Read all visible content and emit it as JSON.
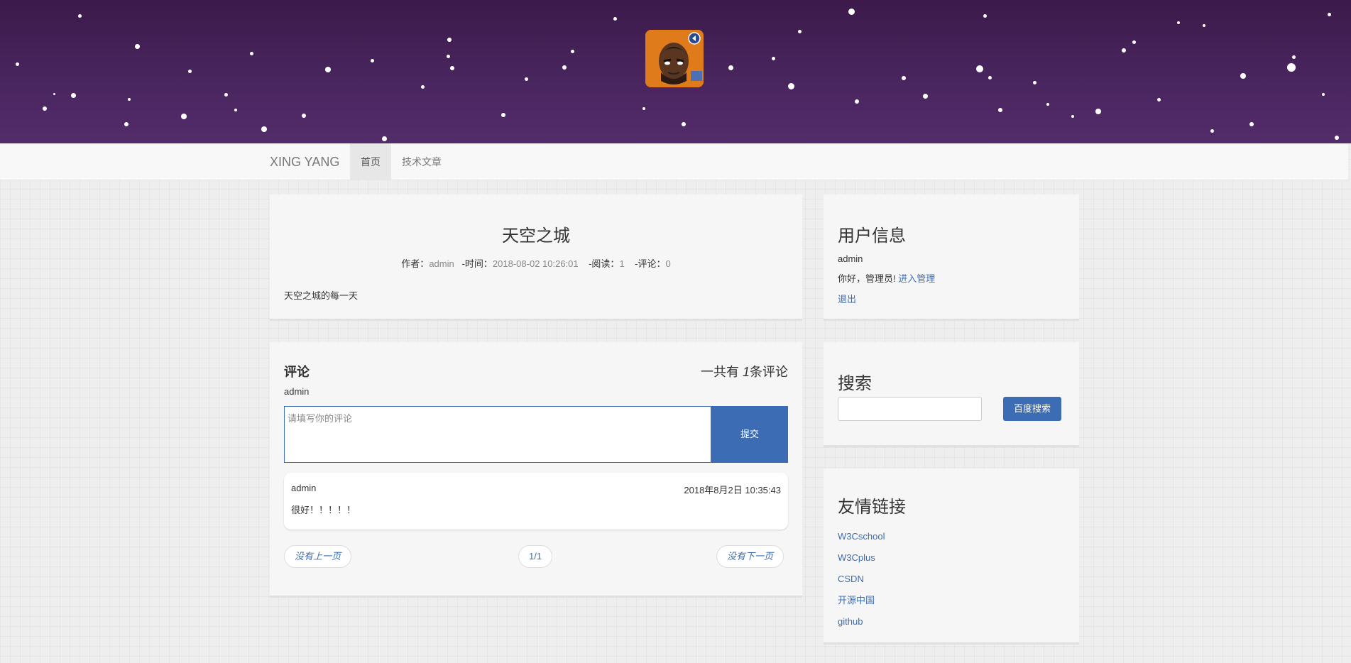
{
  "navbar": {
    "brand": "XING YANG",
    "items": [
      {
        "label": "首页"
      },
      {
        "label": "技术文章"
      }
    ]
  },
  "article": {
    "title": "天空之城",
    "author_label": "作者：",
    "author": "admin",
    "time_label": "-时间：",
    "time": "2018-08-02 10:26:01",
    "reads_label": "-阅读：",
    "reads": "1",
    "comments_label": "-评论：",
    "comments": "0",
    "summary": "天空之城的每一天"
  },
  "comments": {
    "heading": "评论",
    "count_prefix": "一共有",
    "count": "1",
    "count_suffix": "条评论",
    "current_user": "admin",
    "placeholder": "请填写你的评论",
    "submit": "提交",
    "list": [
      {
        "user": "admin",
        "date": "2018年8月2日 10:35:43",
        "text": "很好！！！！！"
      }
    ],
    "pager": {
      "prev": "没有上一页",
      "page": "1/1",
      "next": "没有下一页"
    }
  },
  "user_info": {
    "title": "用户信息",
    "username": "admin",
    "greeting": "你好，管理员!",
    "manage_link": "进入管理",
    "logout": "退出"
  },
  "search": {
    "title": "搜索",
    "button": "百度搜索"
  },
  "links": {
    "title": "友情链接",
    "items": [
      "W3Cschool",
      "W3Cplus",
      "CSDN",
      "开源中国",
      "github"
    ]
  },
  "colors": {
    "accent": "#3c6db4",
    "banner": "#4a2660"
  }
}
